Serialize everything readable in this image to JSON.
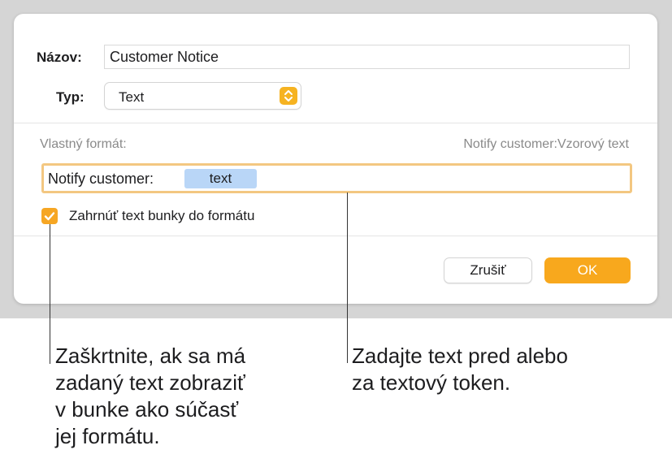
{
  "dialog": {
    "name_label": "Názov:",
    "name_value": "Customer Notice",
    "type_label": "Typ:",
    "type_value": "Text",
    "custom_format_label": "Vlastný formát:",
    "preview": "Notify customer:Vzorový text",
    "format_prefix": "Notify customer:",
    "format_token": "text",
    "include_cell_text_label": "Zahrnúť text bunky do formátu",
    "include_cell_text_checked": true,
    "cancel_label": "Zrušiť",
    "ok_label": "OK"
  },
  "callouts": {
    "checkbox_note": "Zaškrtnite, ak sa má\nzadaný text zobraziť\nv bunke ako súčasť\njej formátu.",
    "field_note": "Zadajte text pred alebo\nza textový token."
  },
  "colors": {
    "accent": "#f8a81d",
    "token_bg": "#b9d6f7",
    "focus_ring": "#f3c781"
  }
}
